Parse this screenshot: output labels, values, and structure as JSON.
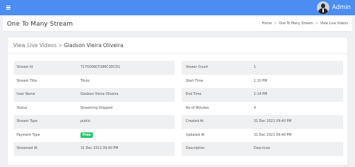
{
  "topbar": {
    "admin_label": "Admin"
  },
  "header": {
    "title": "One To Many Stream",
    "breadcrumb": [
      "Home",
      "One To Many Stream",
      "View Live Videos"
    ]
  },
  "card": {
    "title_prefix": "View Live Videos",
    "title_name": "Gladson Vieira Oliveira"
  },
  "details_left": [
    {
      "label": "Stream Id",
      "value": "7175D06CF286C3DCD1"
    },
    {
      "label": "Stream Title",
      "value": "Titulo"
    },
    {
      "label": "User Name",
      "value": "Gladson Vieira Oliveira"
    },
    {
      "label": "Status",
      "value": "Streaming Stopped"
    },
    {
      "label": "Stream Type",
      "value": "public"
    },
    {
      "label": "Payment Type",
      "value": "Free"
    },
    {
      "label": "Streamed At",
      "value": "31 Dec 2021 09:40 PM"
    }
  ],
  "details_right": [
    {
      "label": "Viewer Count",
      "value": "1"
    },
    {
      "label": "Start Time",
      "value": "1:10 PM"
    },
    {
      "label": "End Time",
      "value": "1:14 PM"
    },
    {
      "label": "No of Minutes",
      "value": "4"
    },
    {
      "label": "Created At",
      "value": "31 Dec 2021 09:40 PM"
    },
    {
      "label": "Updated At",
      "value": "31 Dec 2021 09:48 PM"
    },
    {
      "label": "Description",
      "value": "Descricao"
    }
  ],
  "colors": {
    "topbar": "#4b8df0",
    "badge": "#28c76f"
  }
}
